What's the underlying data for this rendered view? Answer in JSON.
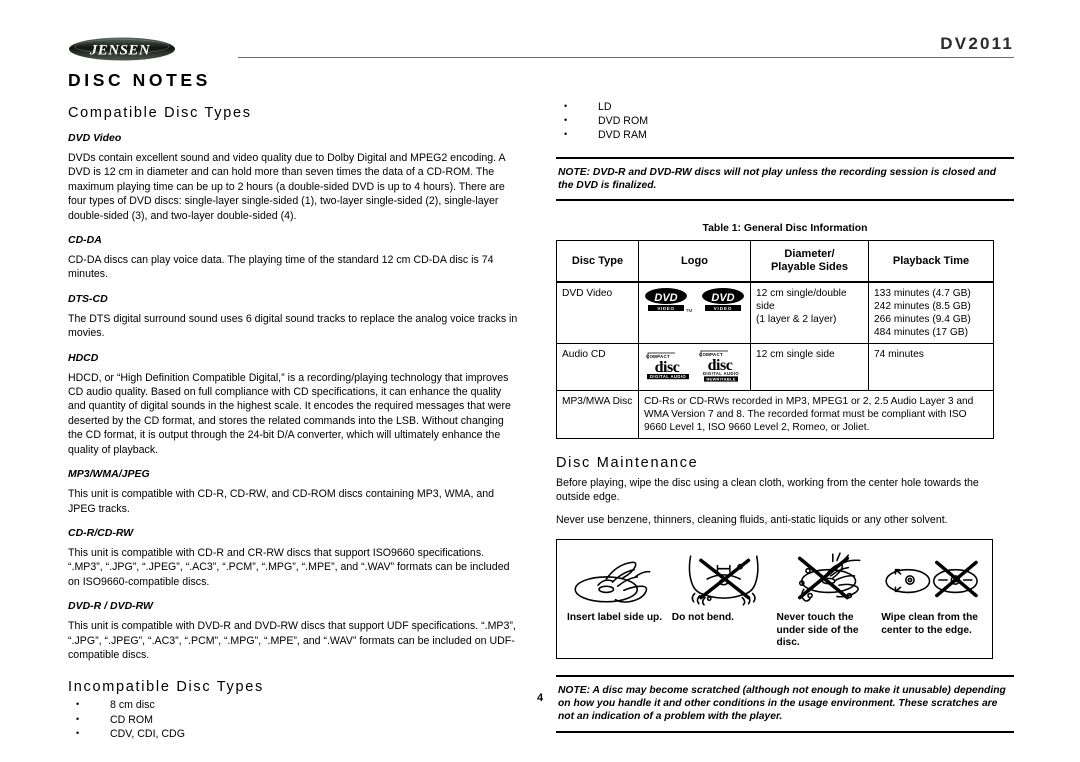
{
  "header": {
    "logo_text": "JENSEN",
    "model": "DV2011"
  },
  "page_number": "4",
  "left": {
    "chapter_title": "DISC NOTES",
    "section_title": "Compatible Disc Types",
    "entries": [
      {
        "heading": "DVD Video",
        "body": "DVDs contain excellent sound and video quality due to Dolby Digital and MPEG2 encoding. A DVD is 12 cm in diameter and can hold more than seven times the data of a CD-ROM. The maximum playing time can be up to 2 hours (a double-sided DVD is up to 4 hours). There are four types of DVD discs: single-layer single-sided (1), two-layer single-sided (2), single-layer double-sided (3), and two-layer double-sided (4)."
      },
      {
        "heading": "CD-DA",
        "body": "CD-DA discs can play voice data. The playing time of the standard 12 cm CD-DA disc is 74 minutes."
      },
      {
        "heading": "DTS-CD",
        "body": "The DTS digital surround sound uses 6 digital sound tracks to replace the analog voice tracks in movies."
      },
      {
        "heading": "HDCD",
        "body": "HDCD, or “High Definition Compatible Digital,” is a recording/playing technology that improves CD audio quality. Based on full compliance with CD specifications, it can enhance the quality and quantity of digital sounds in the highest scale. It encodes the required messages that were deserted by the CD format, and stores the related commands into the LSB. Without changing the CD format, it is output through the 24-bit D/A converter, which will ultimately enhance the quality of playback."
      },
      {
        "heading": "MP3/WMA/JPEG",
        "body": "This unit is compatible with CD-R, CD-RW, and CD-ROM discs containing MP3, WMA, and JPEG tracks."
      },
      {
        "heading": "CD-R/CD-RW",
        "body": "This unit is compatible with CD-R and CR-RW discs that support ISO9660 specifications. “.MP3”, “.JPG”, “.JPEG”, “.AC3”, “.PCM”, “.MPG”, “.MPE”, and “.WAV” formats can be included on ISO9660-compatible discs."
      },
      {
        "heading": "DVD-R / DVD-RW",
        "body": "This unit is compatible with DVD-R and DVD-RW discs that support UDF specifications. “.MP3”, “.JPG”, “.JPEG”, “.AC3”, “.PCM”, “.MPG”, “.MPE”, and “.WAV” formats can be included on UDF-compatible discs."
      }
    ],
    "incompatible_title": "Incompatible Disc Types",
    "incompatible_items": [
      "8 cm disc",
      "CD ROM",
      "CDV, CDI, CDG"
    ]
  },
  "right": {
    "incompatible_items_cont": [
      "LD",
      "DVD ROM",
      "DVD RAM"
    ],
    "note_top": "NOTE: DVD-R and DVD-RW discs will not play unless the recording session is closed and the DVD is finalized.",
    "table": {
      "caption": "Table 1: General Disc Information",
      "columns": [
        "Disc Type",
        "Logo",
        "Diameter/\nPlayable Sides",
        "Playback Time"
      ],
      "column_headers": {
        "c1": "Disc Type",
        "c2": "Logo",
        "c3_line1": "Diameter/",
        "c3_line2": "Playable Sides",
        "c4": "Playback Time"
      },
      "rows": [
        {
          "disc_type": "DVD Video",
          "logos": [
            "dvd-video-tm-logo",
            "dvd-video-logo"
          ],
          "diameter_lines": [
            "12 cm single/double",
            "side",
            "(1 layer & 2 layer)"
          ],
          "playback_lines": [
            "133 minutes (4.7 GB)",
            "242 minutes (8.5 GB)",
            "266 minutes (9.4 GB)",
            "484 minutes (17 GB)"
          ]
        },
        {
          "disc_type": "Audio CD",
          "logos": [
            "compact-disc-digital-audio-logo",
            "compact-disc-digital-audio-rewritable-logo"
          ],
          "diameter_lines": [
            "12 cm single side"
          ],
          "playback_lines": [
            "74 minutes"
          ]
        }
      ],
      "span_row": {
        "disc_type": "MP3/MWA Disc",
        "text": "CD-Rs or CD-RWs recorded in MP3, MPEG1 or 2, 2.5 Audio Layer 3 and WMA Version 7 and 8. The recorded format must be compliant with ISO 9660 Level 1, ISO 9660 Level 2, Romeo, or Joliet."
      }
    },
    "maintenance": {
      "title": "Disc Maintenance",
      "para1": "Before playing, wipe the disc using a clean cloth, working from the center hole towards the outside edge.",
      "para2": "Never use benzene, thinners, cleaning fluids, anti-static liquids or any other solvent."
    },
    "care_items": [
      {
        "icon": "insert-label-side-up-icon",
        "caption": "Insert label side up."
      },
      {
        "icon": "do-not-bend-icon",
        "caption": "Do not bend."
      },
      {
        "icon": "never-touch-underside-icon",
        "caption": "Never touch the under side of the disc."
      },
      {
        "icon": "wipe-center-to-edge-icon",
        "caption": "Wipe clean from the center to the edge."
      }
    ],
    "note_bottom": "NOTE: A disc may become scratched (although not enough to make it unusable) depending on how you handle it and other conditions in the usage environment. These scratches are not an indication of a problem with the player."
  },
  "logos": {
    "dvd_top": "DVD",
    "dvd_bottom_left": "VIDEO",
    "dvd_bottom_right": "VIDEO",
    "dvd_tm": "TM",
    "cd_compact": "COMPACT",
    "cd_disc": "disc",
    "cd_digital_audio": "DIGITAL AUDIO",
    "cd_rewritable": "REWRITABLE"
  }
}
